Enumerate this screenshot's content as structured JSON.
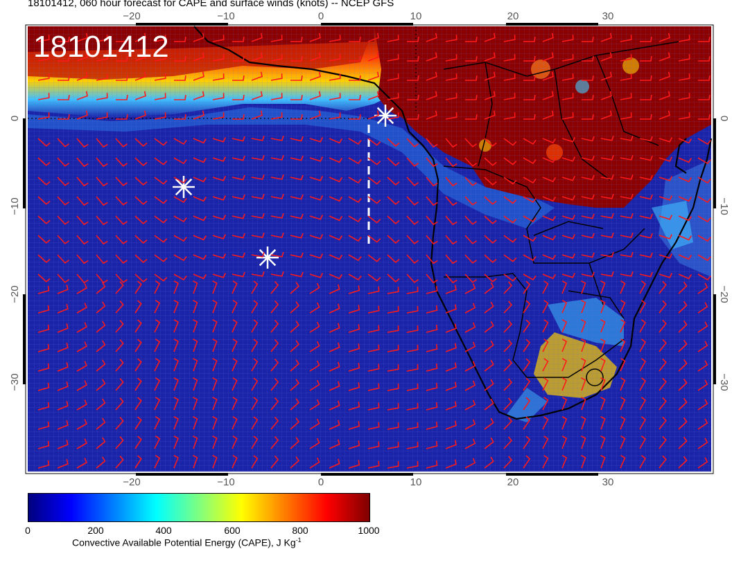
{
  "header": {
    "title": "18101412, 060 hour forecast for CAPE and surface winds (knots) -- NCEP GFS"
  },
  "map": {
    "time_label": "18101412",
    "lon_ticks": [
      "−20",
      "−10",
      "0",
      "10",
      "20",
      "30"
    ],
    "lat_ticks": [
      "0",
      "−10",
      "−20",
      "−30"
    ],
    "colors": {
      "ocean": "#1a24a8",
      "land_high": "#8b0000",
      "wind_barb": "#ff1a1a",
      "coast": "#000000",
      "marker": "#ffffff"
    },
    "icons": [
      "asterisk-marker-icon",
      "wind-barb-icon"
    ]
  },
  "colorbar": {
    "ticks": [
      "0",
      "200",
      "400",
      "600",
      "800",
      "1000"
    ],
    "label_main": "Convective Available Potential Energy (CAPE), J Kg",
    "label_sup": "-1",
    "stops": [
      "#00007f",
      "#0000ff",
      "#007fff",
      "#00ffff",
      "#7fff7f",
      "#ffff00",
      "#ff7f00",
      "#ff0000",
      "#7f0000"
    ]
  }
}
